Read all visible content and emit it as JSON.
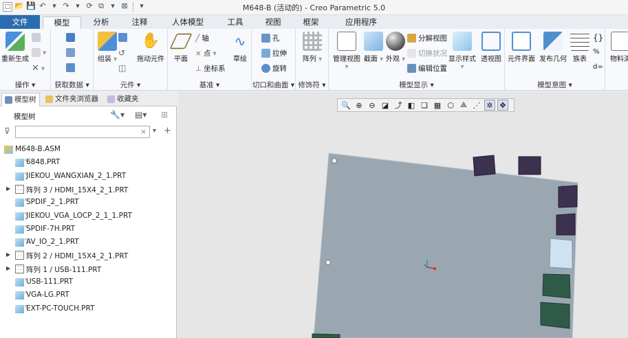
{
  "window": {
    "title": "M648-B (活动的) - Creo Parametric 5.0"
  },
  "ribbon_tabs": [
    "文件",
    "模型",
    "分析",
    "注释",
    "人体模型",
    "工具",
    "视图",
    "框架",
    "应用程序"
  ],
  "active_tab": "模型",
  "ribbon": {
    "groups": {
      "operations": "操作",
      "get_data": "获取数据",
      "component": "元件",
      "datum": "基准",
      "cut_surface": "切口和曲面",
      "modifiers": "修饰符",
      "model_display": "模型显示",
      "model_intent": "模型意图"
    },
    "buttons": {
      "regenerate": "重新生成",
      "assemble": "组装",
      "drag_components": "拖动元件",
      "plane": "平面",
      "axis": "轴",
      "point": "点",
      "csys": "坐标系",
      "sketch": "草绘",
      "hole": "孔",
      "extrude": "拉伸",
      "revolve": "旋转",
      "pattern": "阵列",
      "manage_views": "管理视图",
      "section": "截面",
      "appearance": "外观",
      "explode_view": "分解视图",
      "toggle_status": "切换状况",
      "edit_position": "编辑位置",
      "display_style": "显示样式",
      "perspective_view": "透视图",
      "component_interface": "元件界面",
      "publish_geometry": "发布几何",
      "family_table": "族表",
      "bill_of_materials": "物料清"
    }
  },
  "panel": {
    "tabs": [
      "模型树",
      "文件夹浏览器",
      "收藏夹"
    ],
    "tree_title": "模型树",
    "filter_placeholder": "",
    "root": "M648-B.ASM",
    "items": [
      {
        "type": "part",
        "label": "6848.PRT"
      },
      {
        "type": "part",
        "label": "JIEKOU_WANGXIAN_2_1.PRT"
      },
      {
        "type": "pattern",
        "label": "阵列 3 / HDMI_15X4_2_1.PRT"
      },
      {
        "type": "part",
        "label": "SPDIF_2_1.PRT"
      },
      {
        "type": "part",
        "label": "JIEKOU_VGA_LOCP_2_1_1.PRT"
      },
      {
        "type": "part",
        "label": "SPDIF-7H.PRT"
      },
      {
        "type": "part",
        "label": "AV_IO_2_1.PRT"
      },
      {
        "type": "pattern",
        "label": "阵列 2 / HDMI_15X4_2_1.PRT"
      },
      {
        "type": "pattern",
        "label": "阵列 1 / USB-111.PRT"
      },
      {
        "type": "part",
        "label": "USB-111.PRT"
      },
      {
        "type": "part",
        "label": "VGA-LG.PRT"
      },
      {
        "type": "part",
        "label": "EXT-PC-TOUCH.PRT"
      }
    ]
  },
  "colors": {
    "file_tab": "#2b6cb0",
    "board": "#9aa7b0",
    "connector_dark": "#3c3250",
    "connector_green": "#2f5a48",
    "connector_light": "#cfe2f2"
  }
}
